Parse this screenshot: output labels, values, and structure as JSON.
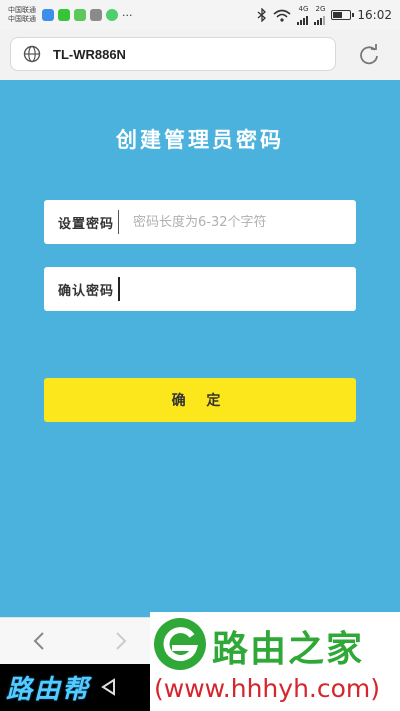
{
  "status_bar": {
    "carrier_1": "中国联通",
    "carrier_2": "中国联通",
    "more": "···",
    "net_1": "4G",
    "net_2": "2G",
    "time": "16:02",
    "battery_level": 0.6
  },
  "browser": {
    "url": "TL-WR886N"
  },
  "page": {
    "title": "创建管理员密码",
    "set_password_label": "设置密码",
    "set_password_placeholder": "密码长度为6-32个字符",
    "set_password_value": "",
    "confirm_password_label": "确认密码",
    "confirm_password_value": "",
    "confirm_button": "确 定",
    "background_color": "#4ab2dc",
    "button_color": "#fce61c"
  },
  "watermark": {
    "left_text": "路由帮",
    "right_cn": "路由之家",
    "right_url": "(www.hhhyh.com)"
  }
}
